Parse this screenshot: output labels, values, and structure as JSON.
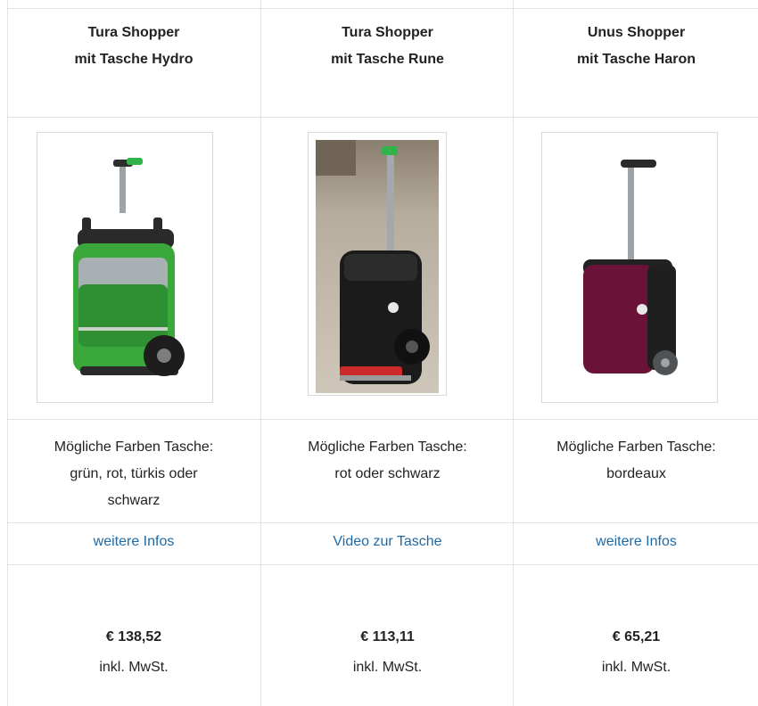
{
  "products": [
    {
      "title_line1": "Tura Shopper",
      "title_line2": "mit Tasche Hydro",
      "colors_line1": "Mögliche Farben Tasche:",
      "colors_line2": "grün, rot, türkis oder",
      "colors_line3": "schwarz",
      "link": "weitere Infos",
      "price": "€ 138,52",
      "vat": "inkl. MwSt.",
      "bag_color": "#3aa83a"
    },
    {
      "title_line1": "Tura Shopper",
      "title_line2": "mit Tasche Rune",
      "colors_line1": "Mögliche Farben Tasche:",
      "colors_line2": "rot oder schwarz",
      "colors_line3": "",
      "link": "Video zur Tasche",
      "price": "€ 113,11",
      "vat": "inkl. MwSt.",
      "bag_color": "#1e1e1e"
    },
    {
      "title_line1": "Unus Shopper",
      "title_line2": "mit Tasche Haron",
      "colors_line1": "Mögliche Farben Tasche:",
      "colors_line2": "bordeaux",
      "colors_line3": "",
      "link": "weitere Infos",
      "price": "€ 65,21",
      "vat": "inkl. MwSt.",
      "bag_color": "#6b1238"
    }
  ],
  "link_color": "#1f6aa5"
}
